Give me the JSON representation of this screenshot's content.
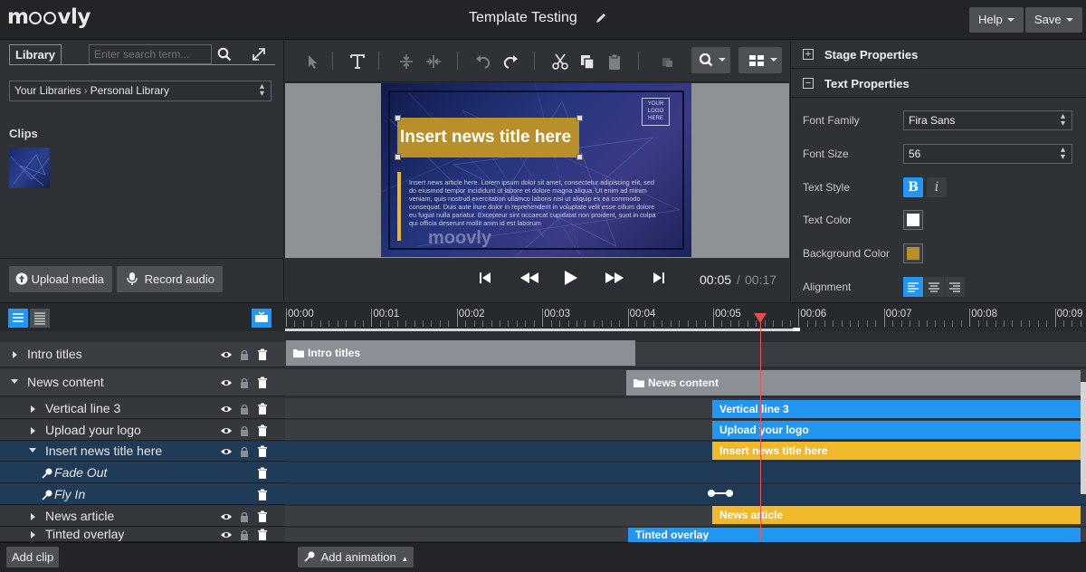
{
  "app": {
    "name": "moovly",
    "title": "Template Testing"
  },
  "header": {
    "help_label": "Help",
    "save_label": "Save"
  },
  "library": {
    "tab_label": "Library",
    "search_placeholder": "Enter search term...",
    "breadcrumb": [
      "Your Libraries",
      "Personal Library"
    ],
    "clips_label": "Clips",
    "upload_label": "Upload media",
    "record_label": "Record audio"
  },
  "stage": {
    "logo_placeholder": "YOUR LOGO HERE",
    "news_title": "Insert news title here",
    "article_text": "Insert news article here.\nLorem ipsum dolor sit amet, consectetur adipiscing elit, sed do eiusmod tempor incididunt ut labore et dolore magna aliqua. Ut enim ad minim veniam, quis nostrud exercitation ullamco laboris nisi ut aliquip ex ea commodo consequat. Duis aute irure dolor in reprehenderit in voluptate velit esse cillum dolore eu fugiat nulla pariatur. Excepteur sint occaecat cupidatat non proident, sunt in culpa qui officia deserunt mollit anim id est laborum",
    "watermark": "moovly"
  },
  "playback": {
    "current_time": "00:05",
    "separator": "/",
    "total_time": "00:17"
  },
  "properties": {
    "stage_header": "Stage Properties",
    "text_header": "Text Properties",
    "font_family_label": "Font Family",
    "font_family_value": "Fira Sans",
    "font_size_label": "Font Size",
    "font_size_value": "56",
    "text_style_label": "Text Style",
    "text_color_label": "Text Color",
    "text_color": "#ffffff",
    "bg_color_label": "Background Color",
    "bg_color": "#b98f2a",
    "alignment_label": "Alignment"
  },
  "timeline": {
    "ticks": [
      "00:00",
      "00:01",
      "00:02",
      "00:03",
      "00:04",
      "00:05",
      "00:06",
      "00:07",
      "00:08",
      "00:09"
    ],
    "rows": [
      {
        "label": "Intro titles"
      },
      {
        "label": "News content"
      },
      {
        "label": "Vertical line 3"
      },
      {
        "label": "Upload your logo"
      },
      {
        "label": "Insert news title here"
      },
      {
        "label": "Fade Out"
      },
      {
        "label": "Fly In"
      },
      {
        "label": "News article"
      },
      {
        "label": "Tinted overlay"
      }
    ],
    "bars": [
      {
        "label": "Intro titles",
        "color": "#8b9096"
      },
      {
        "label": "News content",
        "color": "#8b9096"
      },
      {
        "label": "Vertical line 3",
        "color": "#2196f3"
      },
      {
        "label": "Upload your logo",
        "color": "#2196f3"
      },
      {
        "label": "Insert news title here",
        "color": "#f0b92b"
      },
      {
        "label": "News article",
        "color": "#f0b92b"
      },
      {
        "label": "Tinted overlay",
        "color": "#2196f3"
      }
    ]
  },
  "footer": {
    "add_clip_label": "Add clip",
    "add_animation_label": "Add animation"
  }
}
